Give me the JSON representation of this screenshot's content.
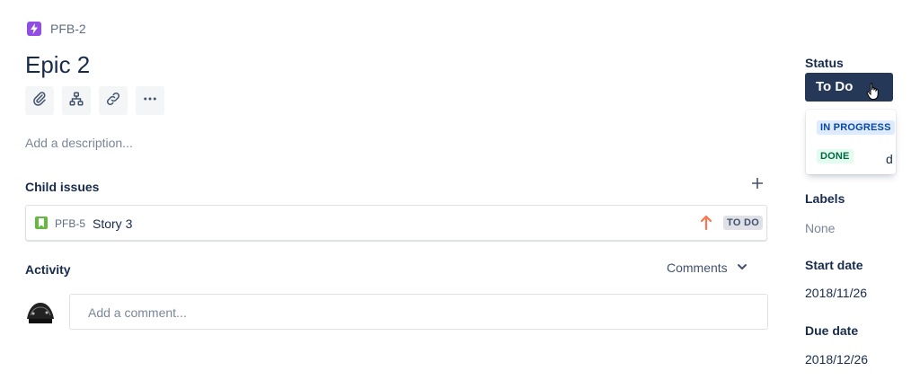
{
  "header": {
    "issue_key": "PFB-2",
    "title": "Epic 2",
    "epic_color": "#904ee2"
  },
  "toolbar": {
    "buttons": [
      {
        "name": "attach",
        "icon": "paperclip-icon"
      },
      {
        "name": "child-issue",
        "icon": "hierarchy-icon"
      },
      {
        "name": "link",
        "icon": "link-icon"
      },
      {
        "name": "more",
        "icon": "more-icon"
      }
    ]
  },
  "description": {
    "placeholder": "Add a description..."
  },
  "child_issues": {
    "title": "Child issues",
    "items": [
      {
        "key": "PFB-5",
        "summary": "Story 3",
        "priority_icon": "arrow-up-icon",
        "status": "TO DO"
      }
    ]
  },
  "activity": {
    "title": "Activity",
    "filter": "Comments",
    "comment_placeholder": "Add a comment..."
  },
  "sidebar": {
    "status_label": "Status",
    "status_value": "To Do",
    "status_options": [
      "IN PROGRESS",
      "DONE"
    ],
    "partial_text": "d",
    "labels_label": "Labels",
    "labels_value": "None",
    "start_date_label": "Start date",
    "start_date_value": "2018/11/26",
    "due_date_label": "Due date",
    "due_date_value": "2018/12/26"
  },
  "colors": {
    "status_button": "#253858",
    "in_progress_bg": "#deebff",
    "in_progress_fg": "#0747a6",
    "done_bg": "#e3fcef",
    "done_fg": "#006644",
    "story": "#63ba3c",
    "priority_high": "#ff7452"
  }
}
